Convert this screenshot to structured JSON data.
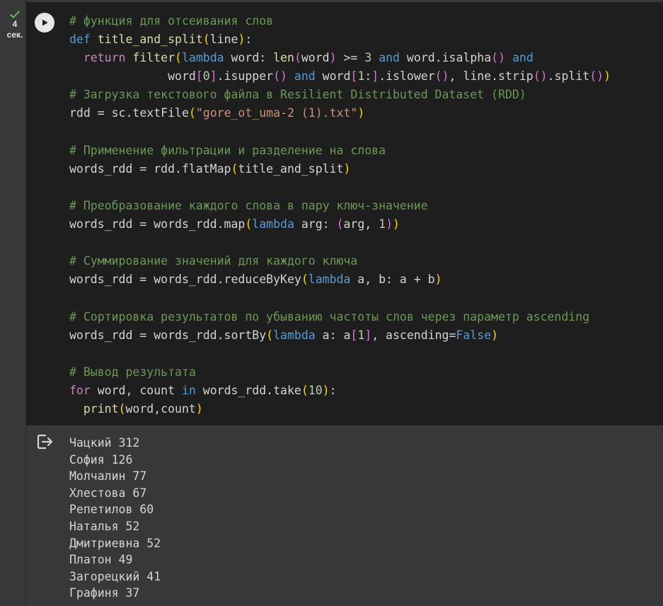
{
  "status": {
    "check": "checkmark-icon",
    "duration_value": "4",
    "duration_unit": "сек."
  },
  "run_button": {
    "icon": "play-icon"
  },
  "code": {
    "lines": [
      "# функция для отсеивания слов",
      "def title_and_split(line):",
      "  return filter(lambda word: len(word) >= 3 and word.isalpha() and",
      "              word[0].isupper() and word[1:].islower(), line.strip().split())",
      "# Загрузка текстового файла в Resilient Distributed Dataset (RDD)",
      "rdd = sc.textFile(\"gore_ot_uma-2 (1).txt\")",
      "",
      "# Применение фильтрации и разделение на слова",
      "words_rdd = rdd.flatMap(title_and_split)",
      "",
      "# Преобразование каждого слова в пару ключ-значение",
      "words_rdd = words_rdd.map(lambda arg: (arg, 1))",
      "",
      "# Суммирование значений для каждого ключа",
      "words_rdd = words_rdd.reduceByKey(lambda a, b: a + b)",
      "",
      "# Сортировка результатов по убыванию частоты слов через параметр ascending",
      "words_rdd = words_rdd.sortBy(lambda a: a[1], ascending=False)",
      "",
      "# Вывод результата",
      "for word, count in words_rdd.take(10):",
      "  print(word,count)"
    ]
  },
  "output": {
    "icon": "output-exit-icon",
    "lines": [
      "Чацкий 312",
      "София 126",
      "Молчалин 77",
      "Хлестова 67",
      "Репетилов 60",
      "Наталья 52",
      "Дмитриевна 52",
      "Платон 49",
      "Загорецкий 41",
      "Графиня 37"
    ]
  },
  "colors": {
    "editor_bg": "#1e1e1e",
    "panel_bg": "#383838",
    "comment": "#6a9955",
    "keyword": "#569cd6",
    "control_flow": "#c586c0",
    "function": "#dcdcaa",
    "string": "#ce9178",
    "number": "#b5cea8",
    "check": "#5cb85c"
  }
}
